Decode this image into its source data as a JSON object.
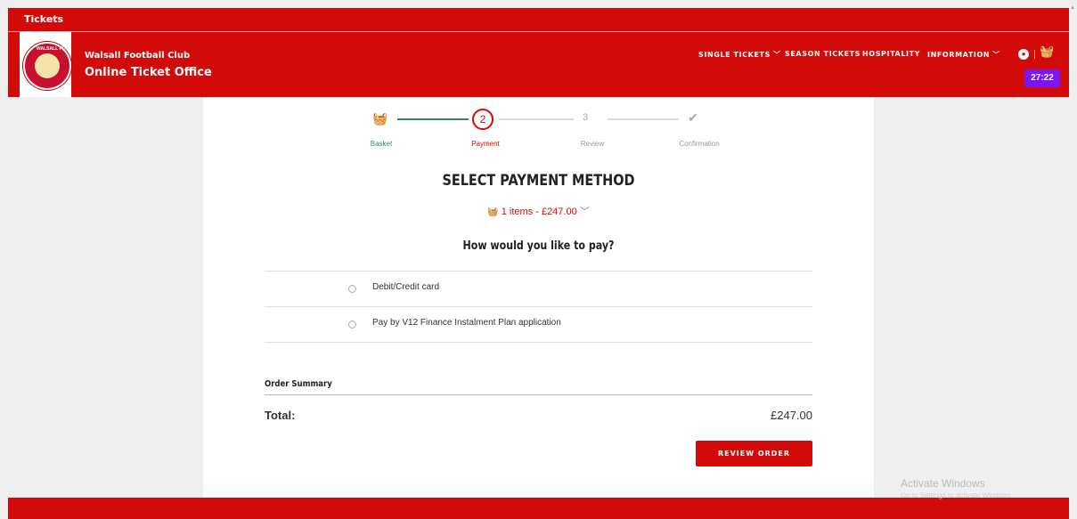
{
  "topbar": {
    "tab_label": "Tickets"
  },
  "header": {
    "club_name": "Walsall Football Club",
    "office_name": "Online Ticket Office",
    "crest_text": "WALSALL FC",
    "nav": [
      {
        "label": "SINGLE TICKETS",
        "has_dropdown": true
      },
      {
        "label": "SEASON TICKETS",
        "has_dropdown": false
      },
      {
        "label": "HOSPITALITY",
        "has_dropdown": false
      },
      {
        "label": "INFORMATION",
        "has_dropdown": true
      }
    ],
    "timer": "27:22",
    "icons": {
      "account": "account-icon",
      "basket": "basket-icon"
    }
  },
  "stepper": {
    "steps": [
      {
        "label": "Basket",
        "marker": "basket",
        "state": "complete"
      },
      {
        "label": "Payment",
        "marker": "2",
        "state": "active"
      },
      {
        "label": "Review",
        "marker": "3",
        "state": "upcoming"
      },
      {
        "label": "Confirmation",
        "marker": "check",
        "state": "upcoming"
      }
    ]
  },
  "payment": {
    "title": "SELECT PAYMENT METHOD",
    "items_summary": "1 items - £247.00",
    "question": "How would you like to pay?",
    "options": [
      {
        "label": "Debit/Credit card",
        "selected": false
      },
      {
        "label": "Pay by V12 Finance Instalment Plan application",
        "selected": false
      }
    ]
  },
  "order": {
    "summary_heading": "Order Summary",
    "total_label": "Total:",
    "total_value": "£247.00",
    "review_button": "REVIEW ORDER"
  },
  "watermark": {
    "title": "Activate Windows",
    "subtitle": "Go to Settings to activate Windows."
  },
  "colors": {
    "brand_red": "#d20a0a",
    "step_green": "#2e8b57",
    "timer_purple": "#7b16f0"
  }
}
